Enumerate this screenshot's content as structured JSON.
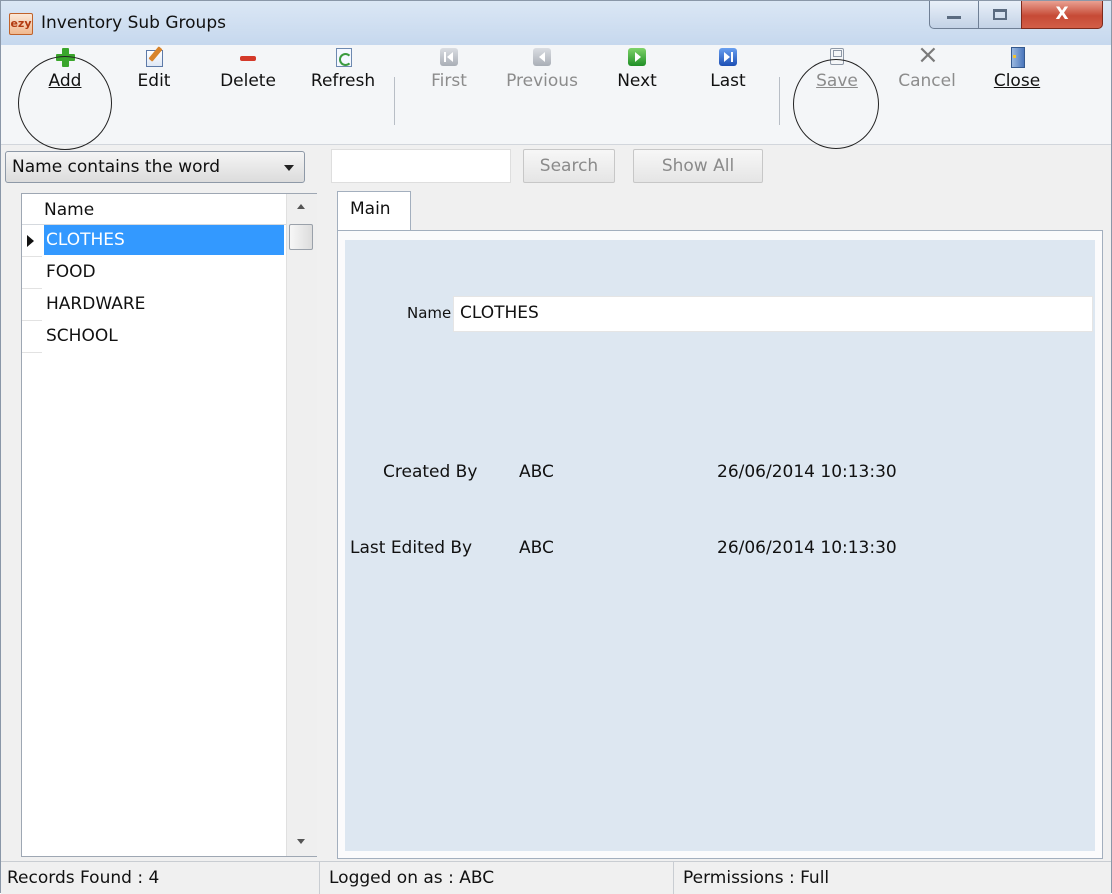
{
  "window": {
    "title": "Inventory Sub Groups",
    "app_icon_text": "ezy"
  },
  "window_controls": {
    "close_glyph": "X"
  },
  "toolbar": {
    "add": "Add",
    "edit": "Edit",
    "delete": "Delete",
    "refresh": "Refresh",
    "first": "First",
    "previous": "Previous",
    "next": "Next",
    "last": "Last",
    "save": "Save",
    "cancel": "Cancel",
    "close": "Close"
  },
  "search": {
    "mode": "Name contains the word",
    "query": "",
    "search_button": "Search",
    "show_all_button": "Show All"
  },
  "grid": {
    "column": "Name",
    "rows": [
      "CLOTHES",
      "FOOD",
      "HARDWARE",
      "SCHOOL"
    ],
    "selected": "CLOTHES"
  },
  "detail": {
    "tab": "Main",
    "name_label": "Name",
    "name_value": "CLOTHES",
    "created_label": "Created By",
    "created_by": "ABC",
    "created_at": "26/06/2014 10:13:30",
    "edited_label": "Last Edited By",
    "edited_by": "ABC",
    "edited_at": "26/06/2014 10:13:30"
  },
  "status": {
    "records": "Records Found : 4",
    "user": "Logged on as : ABC",
    "permissions": "Permissions : Full"
  },
  "colors": {
    "selection": "#3399ff",
    "panel": "#dde7f1",
    "add_icon": "#3aa62c",
    "delete_icon": "#d43a2a"
  }
}
